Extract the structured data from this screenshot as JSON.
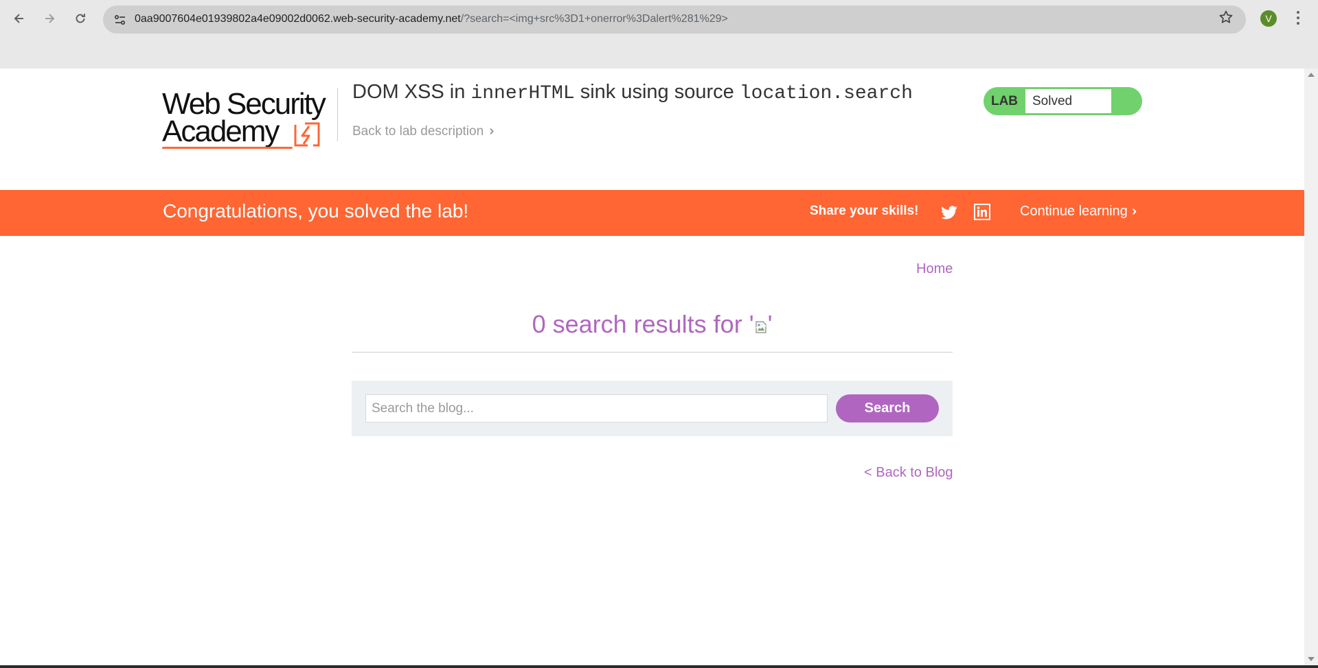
{
  "browser": {
    "url_host": "0aa9007604e01939802a4e09002d0062.web-security-academy.net",
    "url_path": "/?search=<img+src%3D1+onerror%3Dalert%281%29>",
    "profile_initial": "V",
    "icons": [
      "back-arrow-icon",
      "forward-arrow-icon",
      "reload-icon",
      "site-info-icon",
      "bookmark-star-icon",
      "kebab-menu-icon"
    ]
  },
  "header": {
    "logo_line1": "Web Security",
    "logo_line2": "Academy",
    "title_prefix": "DOM XSS in ",
    "title_code1": "innerHTML",
    "title_middle": " sink using source ",
    "title_code2": "location.search",
    "back_link": "Back to lab description",
    "badge_label": "LAB",
    "badge_status": "Solved"
  },
  "banner": {
    "message": "Congratulations, you solved the lab!",
    "share": "Share your skills!",
    "continue": "Continue learning"
  },
  "content": {
    "home_link": "Home",
    "results_prefix": "0 search results for '",
    "results_suffix": "'",
    "search_placeholder": "Search the blog...",
    "search_button": "Search",
    "back_to_blog": "< Back to Blog"
  },
  "colors": {
    "accent": "#ff6633",
    "link": "#b066c0",
    "solved_green": "#70d16d"
  }
}
